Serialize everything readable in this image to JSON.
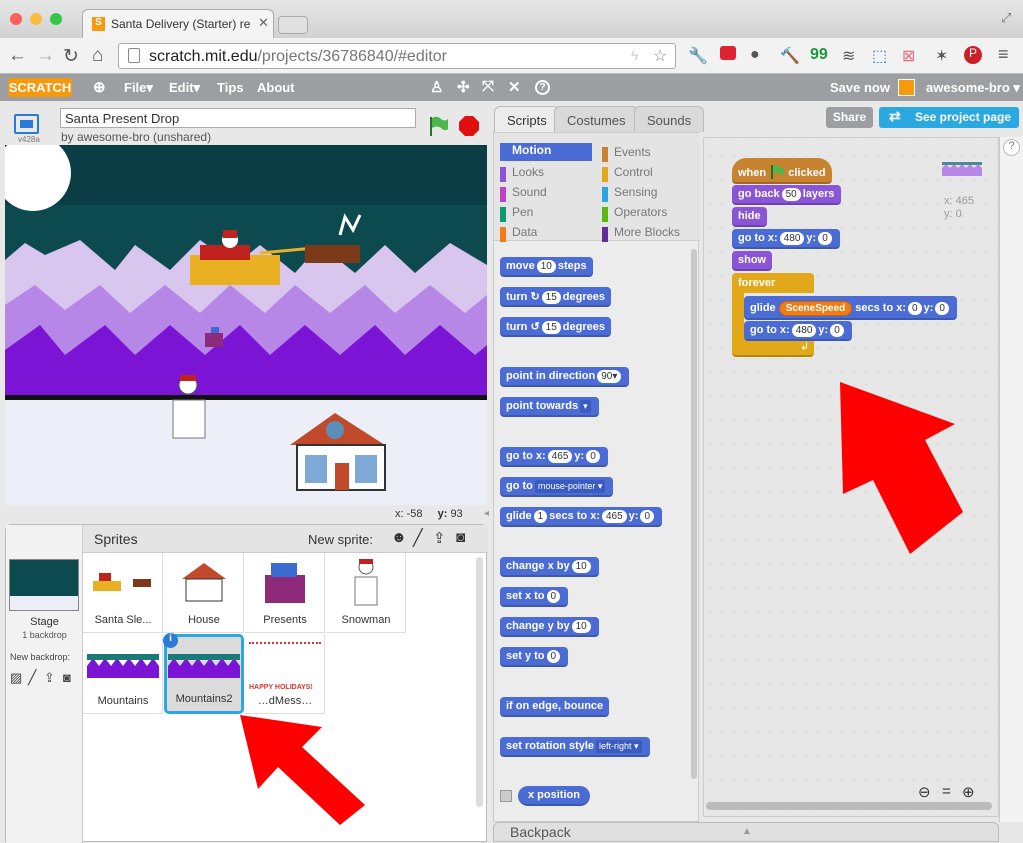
{
  "browser": {
    "tab_title": "Santa Delivery (Starter) re",
    "url_prefix": "scratch.mit.edu",
    "url_path": "/projects/36786840/#editor"
  },
  "scratch_menu": {
    "logo": "SCRATCH",
    "file": "File▾",
    "edit": "Edit▾",
    "tips": "Tips",
    "about": "About",
    "save_now": "Save now",
    "username": "awesome-bro ▾"
  },
  "project": {
    "title": "Santa Present Drop",
    "byline": "by awesome-bro (unshared)",
    "version": "v428a"
  },
  "stage_coords": {
    "x_label": "x:",
    "x": "-58",
    "y_label": "y:",
    "y": "93"
  },
  "sprite_panel": {
    "title": "Sprites",
    "new_sprite": "New sprite:",
    "stage_label": "Stage",
    "stage_sub": "1 backdrop",
    "new_backdrop": "New backdrop:",
    "sprites": [
      {
        "name": "Santa Sle..."
      },
      {
        "name": "House"
      },
      {
        "name": "Presents"
      },
      {
        "name": "Snowman"
      },
      {
        "name": "Mountains"
      },
      {
        "name": "Mountains2"
      },
      {
        "name": "…dMess…"
      }
    ],
    "holiday_text": "HAPPY HOLIDAYS!"
  },
  "tabs": {
    "scripts": "Scripts",
    "costumes": "Costumes",
    "sounds": "Sounds",
    "share": "Share",
    "see_project": "See project page"
  },
  "categories": [
    {
      "name": "Motion",
      "color": "#4a6cd4"
    },
    {
      "name": "Looks",
      "color": "#8a55d7"
    },
    {
      "name": "Sound",
      "color": "#bb42c3"
    },
    {
      "name": "Pen",
      "color": "#0e9a6c"
    },
    {
      "name": "Data",
      "color": "#ee7d16"
    },
    {
      "name": "Events",
      "color": "#c88330"
    },
    {
      "name": "Control",
      "color": "#e1a91a"
    },
    {
      "name": "Sensing",
      "color": "#2ca5e2"
    },
    {
      "name": "Operators",
      "color": "#5cb712"
    },
    {
      "name": "More Blocks",
      "color": "#632d99"
    }
  ],
  "palette_blocks": {
    "move": "move",
    "move_val": "10",
    "steps": "steps",
    "turn": "turn",
    "turn_val": "15",
    "degrees": "degrees",
    "point_dir": "point in direction",
    "dir_val": "90▾",
    "point_towards": "point towards",
    "towards_val": "▾",
    "goto_xy": "go to x:",
    "goto_x": "465",
    "y_lbl": "y:",
    "goto_y": "0",
    "goto": "go to",
    "goto_target": "mouse-pointer ▾",
    "glide": "glide",
    "glide_secs": "1",
    "secs_to_x": "secs to x:",
    "glide_x": "465",
    "glide_y": "0",
    "change_x": "change x by",
    "change_x_val": "10",
    "set_x": "set x to",
    "set_x_val": "0",
    "change_y": "change y by",
    "change_y_val": "10",
    "set_y": "set y to",
    "set_y_val": "0",
    "bounce": "if on edge, bounce",
    "rot_style": "set rotation style",
    "rot_val": "left-right ▾",
    "x_position": "x position"
  },
  "script": {
    "when": "when",
    "clicked": "clicked",
    "go_back": "go back",
    "layers_val": "50",
    "layers": "layers",
    "hide": "hide",
    "goto": "go to x:",
    "x1": "480",
    "y_lbl": "y:",
    "y1": "0",
    "show": "show",
    "forever": "forever",
    "glide": "glide",
    "scene_speed": "SceneSpeed",
    "secs_to_x": "secs to x:",
    "gx": "0",
    "gy": "0",
    "goto2": "go to x:",
    "x2": "480",
    "y2": "0"
  },
  "sprite_info": {
    "x": "x: 465",
    "y": "y: 0"
  },
  "backpack": "Backpack",
  "colors": {
    "motion": "#4a6cd4",
    "looks": "#8a55d7",
    "events": "#c88330",
    "control": "#e1a91a",
    "share": "#29a9e0",
    "arrow": "#f00"
  }
}
